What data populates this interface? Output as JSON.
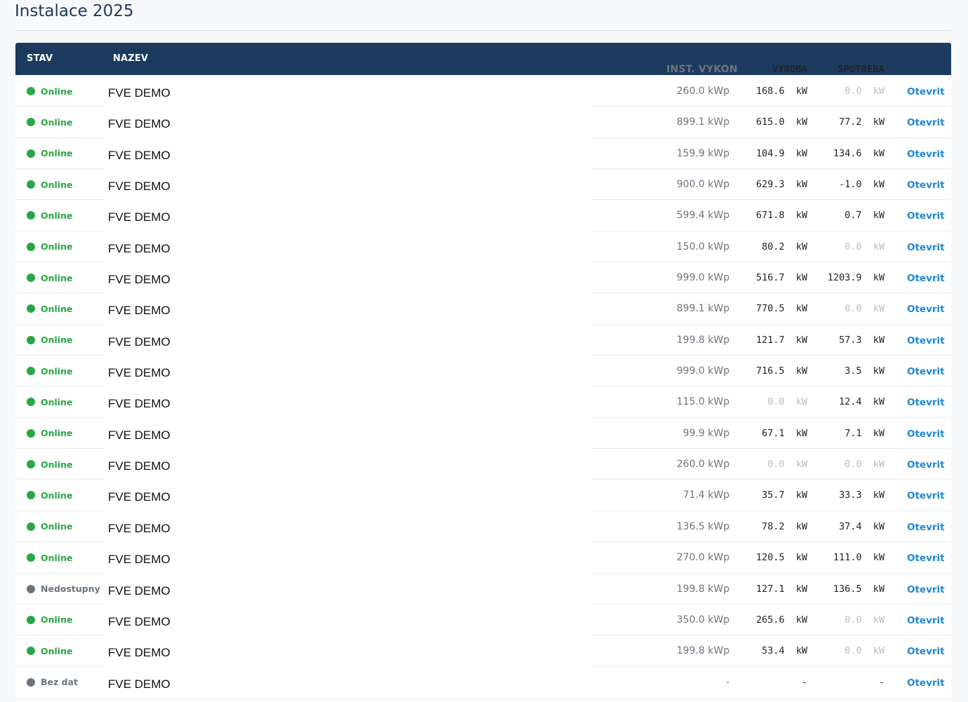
{
  "page": {
    "title": "Instalace 2025"
  },
  "table": {
    "headers": {
      "stav": "STAV",
      "nazev": "NAZEV",
      "vykon": "INST. VYKON",
      "vyroba": "VYROBA",
      "spotreba": "SPOTREBA"
    },
    "unit_kw": "kW",
    "link_label": "Otevrit",
    "rows": [
      {
        "status": "Online",
        "state": "online",
        "name": "FVE DEMO",
        "vykon": "260.0 kWp",
        "vyroba": "168.6",
        "spotreba": "0.0"
      },
      {
        "status": "Online",
        "state": "online",
        "name": "FVE DEMO",
        "vykon": "899.1 kWp",
        "vyroba": "615.0",
        "spotreba": "77.2"
      },
      {
        "status": "Online",
        "state": "online",
        "name": "FVE DEMO",
        "vykon": "159.9 kWp",
        "vyroba": "104.9",
        "spotreba": "134.6"
      },
      {
        "status": "Online",
        "state": "online",
        "name": "FVE DEMO",
        "vykon": "900.0 kWp",
        "vyroba": "629.3",
        "spotreba": "-1.0"
      },
      {
        "status": "Online",
        "state": "online",
        "name": "FVE DEMO",
        "vykon": "599.4 kWp",
        "vyroba": "671.8",
        "spotreba": "0.7"
      },
      {
        "status": "Online",
        "state": "online",
        "name": "FVE DEMO",
        "vykon": "150.0 kWp",
        "vyroba": "80.2",
        "spotreba": "0.0"
      },
      {
        "status": "Online",
        "state": "online",
        "name": "FVE DEMO",
        "vykon": "999.0 kWp",
        "vyroba": "516.7",
        "spotreba": "1203.9"
      },
      {
        "status": "Online",
        "state": "online",
        "name": "FVE DEMO",
        "vykon": "899.1 kWp",
        "vyroba": "770.5",
        "spotreba": "0.0"
      },
      {
        "status": "Online",
        "state": "online",
        "name": "FVE DEMO",
        "vykon": "199.8 kWp",
        "vyroba": "121.7",
        "spotreba": "57.3"
      },
      {
        "status": "Online",
        "state": "online",
        "name": "FVE DEMO",
        "vykon": "999.0 kWp",
        "vyroba": "716.5",
        "spotreba": "3.5"
      },
      {
        "status": "Online",
        "state": "online",
        "name": "FVE DEMO",
        "vykon": "115.0 kWp",
        "vyroba": "0.0",
        "spotreba": "12.4"
      },
      {
        "status": "Online",
        "state": "online",
        "name": "FVE DEMO",
        "vykon": "99.9 kWp",
        "vyroba": "67.1",
        "spotreba": "7.1"
      },
      {
        "status": "Online",
        "state": "online",
        "name": "FVE DEMO",
        "vykon": "260.0 kWp",
        "vyroba": "0.0",
        "spotreba": "0.0"
      },
      {
        "status": "Online",
        "state": "online",
        "name": "FVE DEMO",
        "vykon": "71.4 kWp",
        "vyroba": "35.7",
        "spotreba": "33.3"
      },
      {
        "status": "Online",
        "state": "online",
        "name": "FVE DEMO",
        "vykon": "136.5 kWp",
        "vyroba": "78.2",
        "spotreba": "37.4"
      },
      {
        "status": "Online",
        "state": "online",
        "name": "FVE DEMO",
        "vykon": "270.0 kWp",
        "vyroba": "120.5",
        "spotreba": "111.0"
      },
      {
        "status": "Nedostupny",
        "state": "offline",
        "name": "FVE DEMO",
        "vykon": "199.8 kWp",
        "vyroba": "127.1",
        "spotreba": "136.5"
      },
      {
        "status": "Online",
        "state": "online",
        "name": "FVE DEMO",
        "vykon": "350.0 kWp",
        "vyroba": "265.6",
        "spotreba": "0.0"
      },
      {
        "status": "Online",
        "state": "online",
        "name": "FVE DEMO",
        "vykon": "199.8 kWp",
        "vyroba": "53.4",
        "spotreba": "0.0"
      },
      {
        "status": "Bez dat",
        "state": "offline",
        "name": "FVE DEMO",
        "vykon": "-",
        "vyroba": "-",
        "spotreba": "-"
      }
    ]
  },
  "colors": {
    "header_bg": "#1b3a5e",
    "online": "#28a745",
    "offline": "#6c757d",
    "link": "#1e87d9",
    "muted_zero": "#b8bec4"
  }
}
